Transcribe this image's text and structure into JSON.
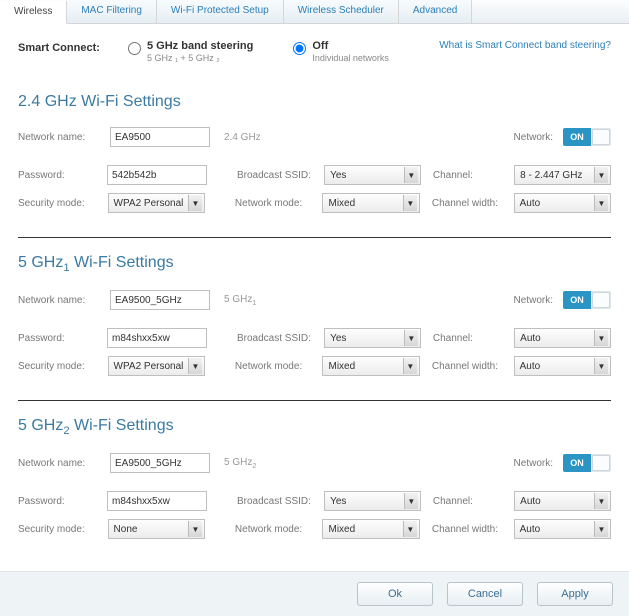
{
  "tabs": {
    "wireless": "Wireless",
    "mac": "MAC Filtering",
    "wps": "Wi-Fi Protected Setup",
    "scheduler": "Wireless Scheduler",
    "advanced": "Advanced"
  },
  "smart": {
    "label": "Smart Connect:",
    "opt1_title": "5 GHz band steering",
    "opt1_sub": "5 GHz ₁ + 5 GHz ₂",
    "opt2_title": "Off",
    "opt2_sub": "Individual networks",
    "help": "What is Smart Connect band steering?"
  },
  "labels": {
    "network_name": "Network name:",
    "password": "Password:",
    "security_mode": "Security mode:",
    "broadcast_ssid": "Broadcast SSID:",
    "network_mode": "Network mode:",
    "channel": "Channel:",
    "channel_width": "Channel width:",
    "network": "Network:",
    "on": "ON"
  },
  "band24": {
    "title": "2.4 GHz Wi-Fi Settings",
    "tag": "2.4 GHz",
    "network_name": "EA9500",
    "password": "542b542b",
    "security_mode": "WPA2 Personal",
    "broadcast_ssid": "Yes",
    "network_mode": "Mixed",
    "channel": "8 - 2.447 GHz",
    "channel_width": "Auto"
  },
  "band51": {
    "title": "5 GHz₁ Wi-Fi Settings",
    "tag": "5 GHz₁",
    "network_name": "EA9500_5GHz",
    "password": "m84shxx5xw",
    "security_mode": "WPA2 Personal",
    "broadcast_ssid": "Yes",
    "network_mode": "Mixed",
    "channel": "Auto",
    "channel_width": "Auto"
  },
  "band52": {
    "title": "5 GHz₂ Wi-Fi Settings",
    "tag": "5 GHz₂",
    "network_name": "EA9500_5GHz",
    "password": "m84shxx5xw",
    "security_mode": "None",
    "broadcast_ssid": "Yes",
    "network_mode": "Mixed",
    "channel": "Auto",
    "channel_width": "Auto"
  },
  "footer": {
    "ok": "Ok",
    "cancel": "Cancel",
    "apply": "Apply"
  }
}
